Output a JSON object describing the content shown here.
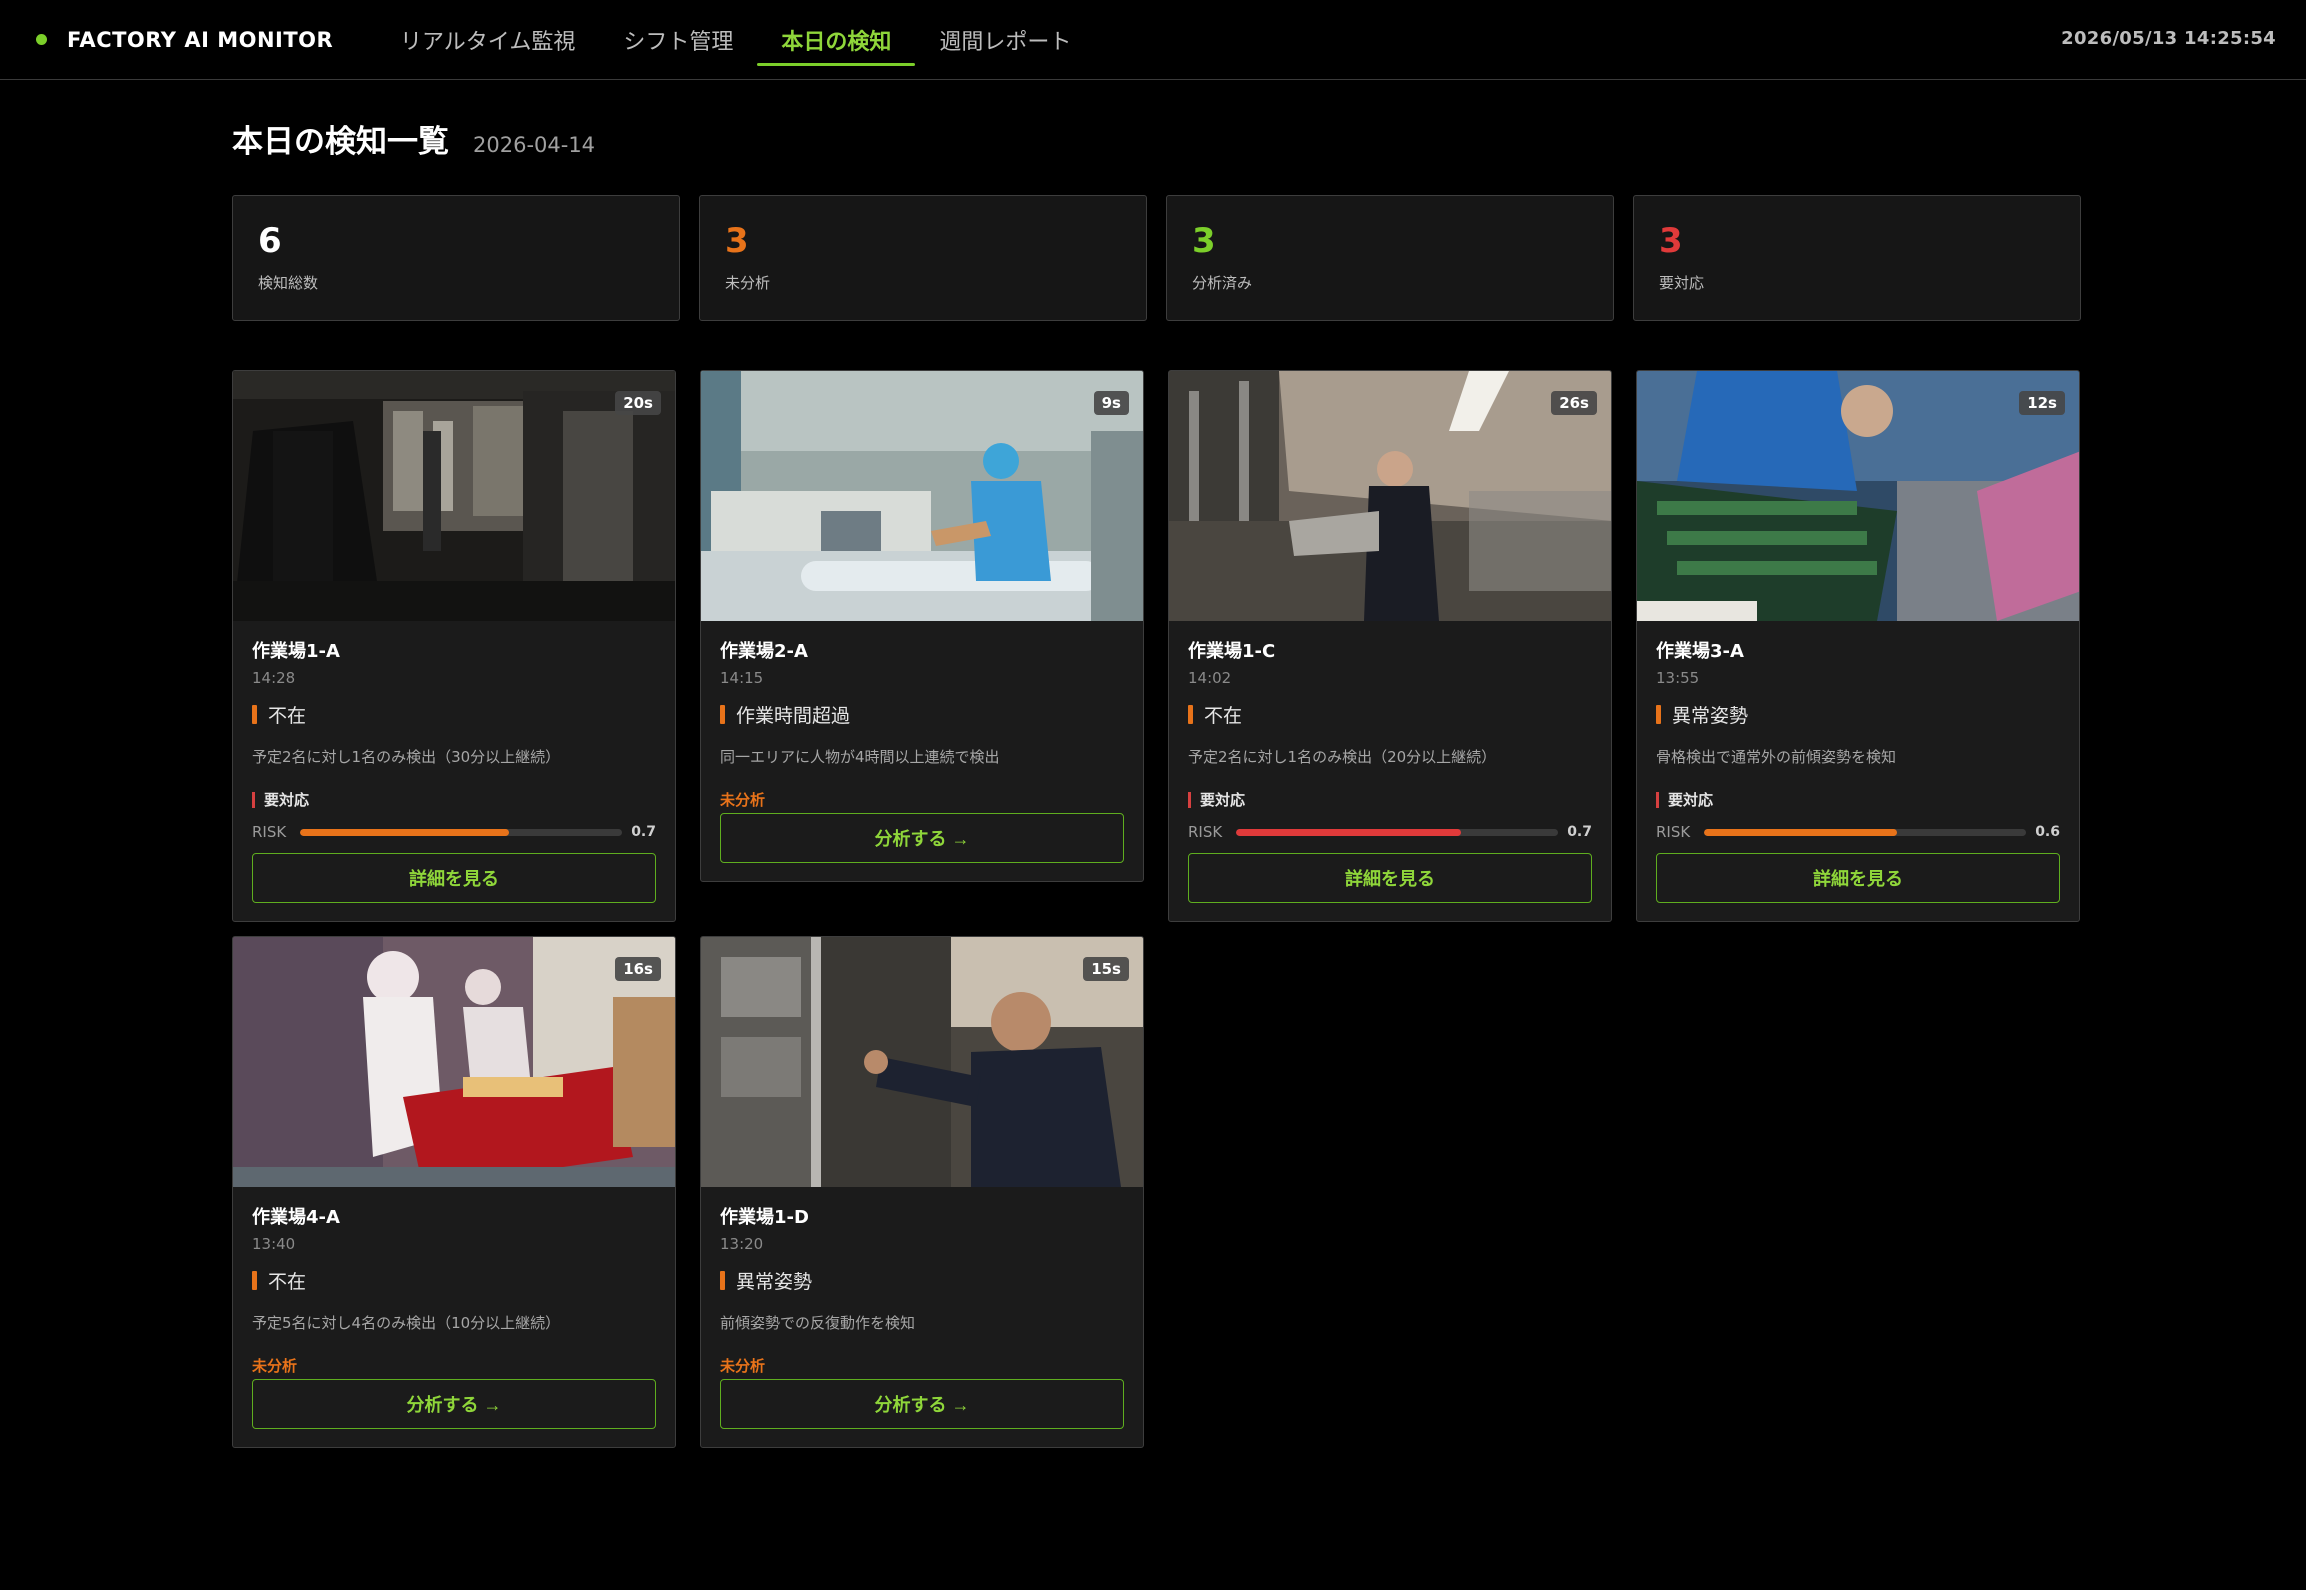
{
  "header": {
    "brand": "FACTORY AI MONITOR",
    "tabs": [
      {
        "label": "リアルタイム監視",
        "active": false
      },
      {
        "label": "シフト管理",
        "active": false
      },
      {
        "label": "本日の検知",
        "active": true
      },
      {
        "label": "週間レポート",
        "active": false
      }
    ],
    "clock": "2026/05/13 14:25:54"
  },
  "page": {
    "title": "本日の検知一覧",
    "date": "2026-04-14"
  },
  "stats": [
    {
      "value": "6",
      "label": "検知総数",
      "color": "#ffffff"
    },
    {
      "value": "3",
      "label": "未分析",
      "color": "#e8731a"
    },
    {
      "value": "3",
      "label": "分析済み",
      "color": "#7ccf2a"
    },
    {
      "value": "3",
      "label": "要対応",
      "color": "#e03a3a"
    }
  ],
  "cards": [
    {
      "duration": "20s",
      "location": "作業場1-A",
      "time": "14:28",
      "type": "不在",
      "description": "予定2名に対し1名のみ検出（30分以上継続）",
      "status": "要対応",
      "risk_label": "RISK",
      "risk": 0.65,
      "risk_text": "0.7",
      "risk_color": "#e8731a",
      "button": "詳細を見る",
      "scene": "clothes-warehouse"
    },
    {
      "duration": "9s",
      "location": "作業場2-A",
      "time": "14:15",
      "type": "作業時間超過",
      "description": "同一エリアに人物が4時間以上連続で検出",
      "status": "未分析",
      "button": "分析する →",
      "scene": "textile-machine"
    },
    {
      "duration": "26s",
      "location": "作業場1-C",
      "time": "14:02",
      "type": "不在",
      "description": "予定2名に対し1名のみ検出（20分以上継続）",
      "status": "要対応",
      "risk_label": "RISK",
      "risk": 0.7,
      "risk_text": "0.7",
      "risk_color": "#e03a3a",
      "button": "詳細を見る",
      "scene": "warehouse-shelves"
    },
    {
      "duration": "12s",
      "location": "作業場3-A",
      "time": "13:55",
      "type": "異常姿勢",
      "description": "骨格検出で通常外の前傾姿勢を検知",
      "status": "要対応",
      "risk_label": "RISK",
      "risk": 0.6,
      "risk_text": "0.6",
      "risk_color": "#e8731a",
      "button": "詳細を見る",
      "scene": "circuit-board"
    },
    {
      "duration": "16s",
      "location": "作業場4-A",
      "time": "13:40",
      "type": "不在",
      "description": "予定5名に対し4名のみ検出（10分以上継続）",
      "status": "未分析",
      "button": "分析する →",
      "scene": "food-line"
    },
    {
      "duration": "15s",
      "location": "作業場1-D",
      "time": "13:20",
      "type": "異常姿勢",
      "description": "前傾姿勢での反復動作を検知",
      "status": "未分析",
      "button": "分析する →",
      "scene": "shelf-worker"
    }
  ]
}
